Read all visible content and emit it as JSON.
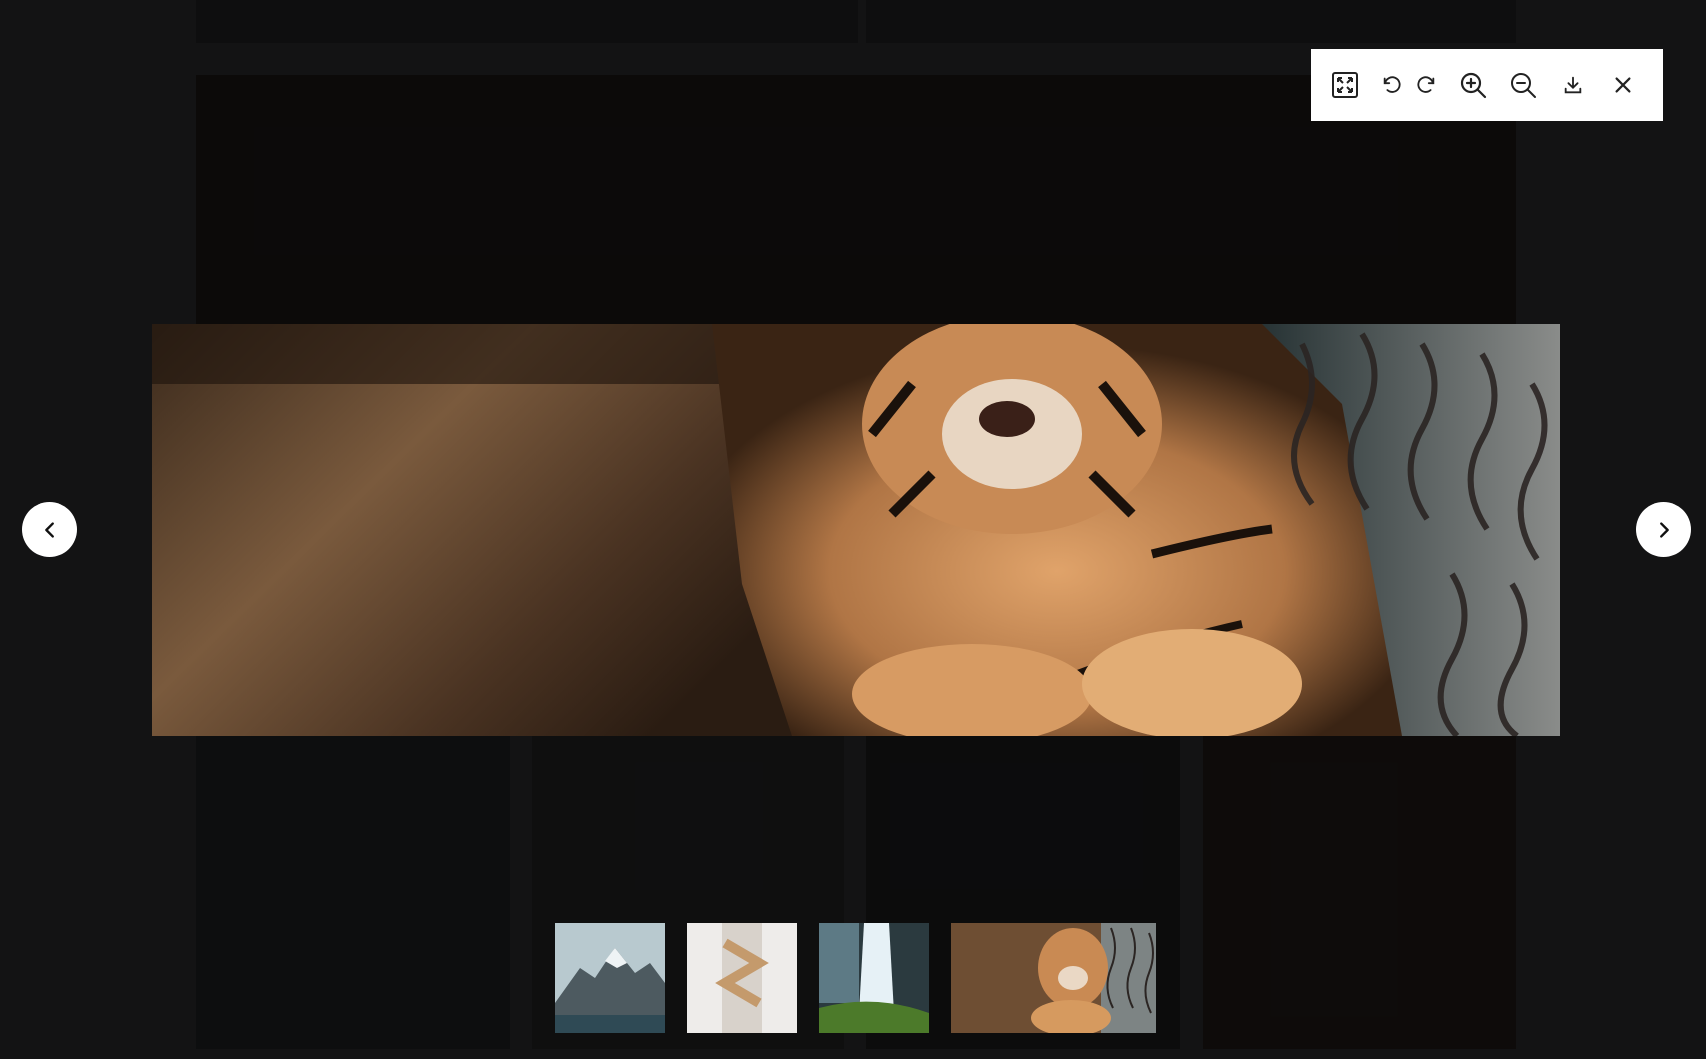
{
  "viewer": {
    "toolbar": {
      "icons": [
        "fullscreen-icon",
        "rotate-left-icon",
        "rotate-right-icon",
        "zoom-in-icon",
        "zoom-out-icon",
        "download-icon",
        "close-icon"
      ]
    },
    "navigation": {
      "prev_icon": "chevron-left-icon",
      "next_icon": "chevron-right-icon"
    },
    "main_image": {
      "subject": "tiger"
    },
    "thumbnails": [
      {
        "subject": "mountain"
      },
      {
        "subject": "staircase"
      },
      {
        "subject": "waterfall"
      },
      {
        "subject": "tiger",
        "active": true
      }
    ]
  },
  "colors": {
    "page_background": "#1b1c1d",
    "toolbar_background": "#ffffff",
    "icon_color": "#222222"
  }
}
